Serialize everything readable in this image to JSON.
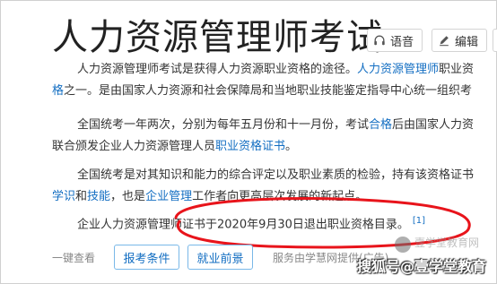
{
  "title": "人力资源管理师考试",
  "toolbar": {
    "voice_label": "语音",
    "edit_label": "编辑"
  },
  "paragraphs": {
    "p1_l1_a": "人力资源管理师考试是获得人力资源职业资格的途径。",
    "p1_l1_link": "人力资源管理师",
    "p1_l1_b": "职业资",
    "p1_l2_link": "格",
    "p1_l2_b": "之一。是由国家人力资源和社会保障局和当地职业技能鉴定指导中心统一组织考",
    "p2_l1_a": "全国统考一年两次，分别为每年五月份和十一月份，考试",
    "p2_l1_link": "合格",
    "p2_l1_b": "后由国家人力资",
    "p2_l2_a": "联合颁发企业人力资源管理人员",
    "p2_l2_link": "职业资格证书",
    "p2_l2_b": "。",
    "p3_l1": "全国统考是对其知识和能力的综合评定以及职业素质的检验，持有该资格证书",
    "p3_l2_link1": "学识",
    "p3_l2_mid": "和",
    "p3_l2_link2": "技能",
    "p3_l2_mid2": "，也是",
    "p3_l2_link3": "企业管理",
    "p3_l2_b": "工作者向更高层次发展的新起点。",
    "p4": "企业人力资源管理师证书于2020年9月30日退出职业资格目录。",
    "p4_ref": "[1]"
  },
  "bottom": {
    "quick_view": "一键查看",
    "btn_conditions": "报考条件",
    "btn_prospects": "就业前景",
    "service": "服务由学慧网提供(广告)"
  },
  "watermark": {
    "text": "搜狐号@壹学堂教育",
    "faint": "壹学堂教育网"
  },
  "annotation_color": "#e8141b"
}
